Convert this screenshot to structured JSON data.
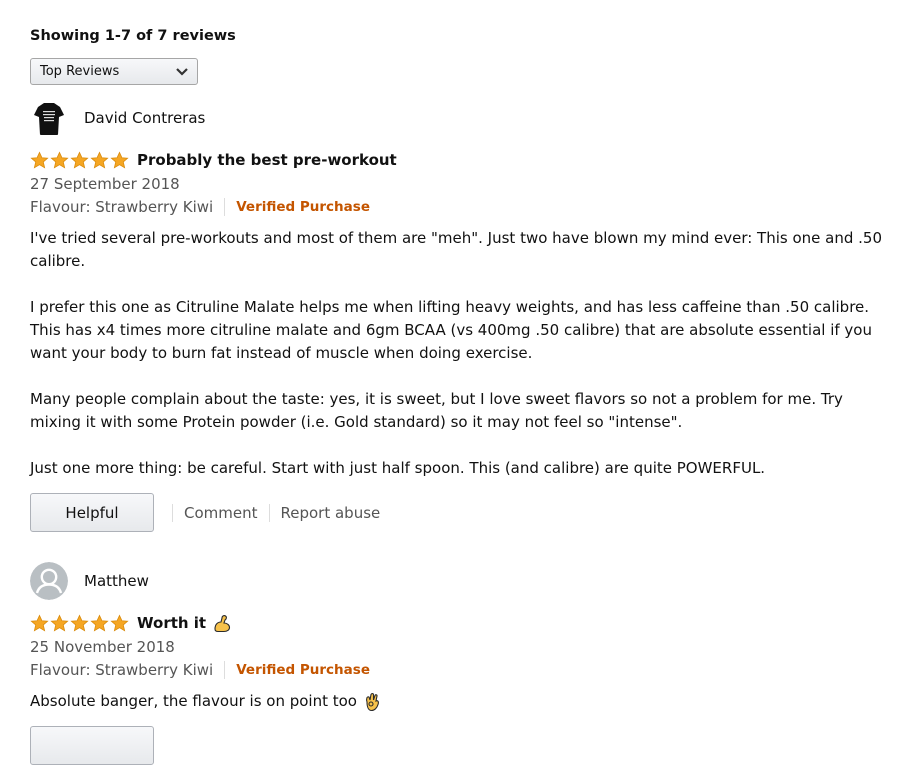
{
  "header": {
    "summary": "Showing 1-7 of 7 reviews",
    "sort_selected": "Top Reviews"
  },
  "reviews": [
    {
      "author": "David Contreras",
      "avatar_icon": "tshirt-photo-avatar",
      "rating": 5,
      "title": "Probably the best pre-workout",
      "title_emoji": "",
      "date": "27 September 2018",
      "flavour": "Flavour: Strawberry Kiwi",
      "verified": "Verified Purchase",
      "paragraphs": [
        "I've tried several pre-workouts and most of them are \"meh\". Just two have blown my mind ever: This one and .50 calibre.",
        "I prefer this one as Citruline Malate helps me when lifting heavy weights, and has less caffeine than .50 calibre. This has x4 times more citruline malate and 6gm BCAA (vs 400mg .50 calibre) that are absolute essential if you want your body to burn fat instead of muscle when doing exercise.",
        "Many people complain about the taste: yes, it is sweet, but I love sweet flavors so not a problem for me. Try mixing it with some Protein powder (i.e. Gold standard) so it may not feel so \"intense\".",
        "Just one more thing: be careful. Start with just half spoon. This (and calibre) are quite POWERFUL."
      ],
      "helpful_label": "Helpful",
      "comment_label": "Comment",
      "report_label": "Report abuse"
    },
    {
      "author": "Matthew",
      "avatar_icon": "default-user-avatar",
      "rating": 5,
      "title": "Worth it",
      "title_emoji": "flexed-biceps-emoji",
      "date": "25 November 2018",
      "flavour": "Flavour: Strawberry Kiwi",
      "verified": "Verified Purchase",
      "paragraphs": [
        "Absolute banger, the flavour is on point too"
      ],
      "body_emoji": "ok-hand-emoji"
    }
  ],
  "colors": {
    "star": "#f5a623",
    "verified": "#c45500",
    "muted_text": "#555555"
  }
}
